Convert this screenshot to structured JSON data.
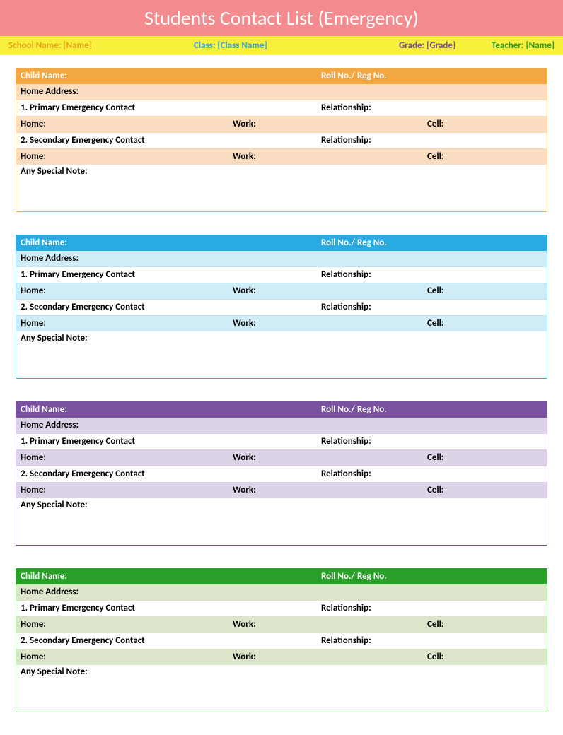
{
  "title": "Students Contact List (Emergency)",
  "info": {
    "school_label": "School Name:",
    "school_value": "[Name]",
    "class_label": "Class:",
    "class_value": "[Class Name]",
    "grade_label": "Grade:",
    "grade_value": "[Grade]",
    "teacher_label": "Teacher:",
    "teacher_value": "[Name]"
  },
  "labels": {
    "child_name": "Child Name:",
    "roll_no": "Roll No./ Reg No.",
    "home_address": "Home Address:",
    "primary_contact": "1. Primary Emergency Contact",
    "secondary_contact": "2. Secondary Emergency Contact",
    "relationship": "Relationship:",
    "home": "Home:",
    "work": "Work:",
    "cell": "Cell:",
    "special_note": "Any Special Note:"
  },
  "cards": [
    {
      "theme": "orange"
    },
    {
      "theme": "blue"
    },
    {
      "theme": "purple"
    },
    {
      "theme": "green"
    }
  ]
}
